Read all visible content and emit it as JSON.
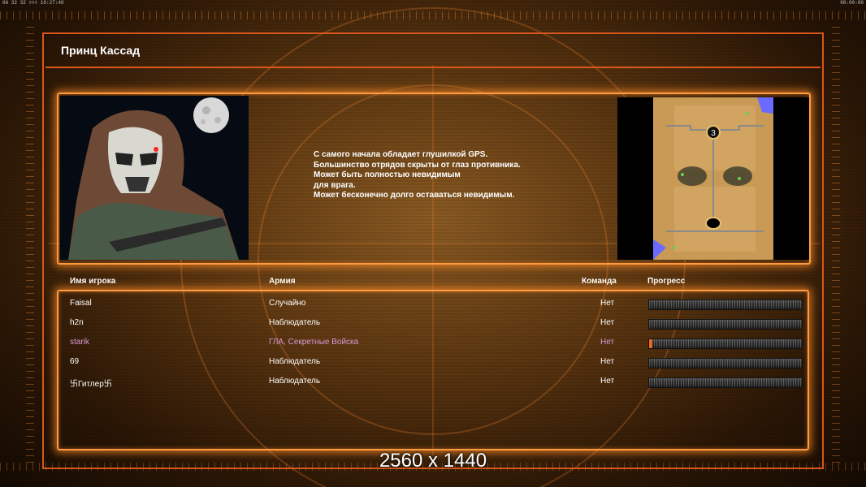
{
  "status": {
    "left": "06 32 32 ◊◊◊ 10:27:40",
    "right": "00:00:00"
  },
  "title": "Принц Кассад",
  "description": [
    "С самого начала обладает глушилкой GPS.",
    "Большинство отрядов скрыты от глаз противника.",
    "Может быть полностью невидимым",
    "для врага.",
    "Может бесконечно долго оставаться невидимым."
  ],
  "minimap": {
    "marker": "3"
  },
  "columns": {
    "player": "Имя игрока",
    "army": "Армия",
    "team": "Команда",
    "progress": "Прогресс"
  },
  "players": [
    {
      "name": "Faisal",
      "army": "Случайно",
      "team": "Нет",
      "progress": 0,
      "highlight": false
    },
    {
      "name": "h2n",
      "army": "Наблюдатель",
      "team": "Нет",
      "progress": 0,
      "highlight": false
    },
    {
      "name": "starik",
      "army": "ГЛА, Секретные Войска",
      "team": "Нет",
      "progress": 0.02,
      "highlight": true
    },
    {
      "name": "69",
      "army": "Наблюдатель",
      "team": "Нет",
      "progress": 0,
      "highlight": false
    },
    {
      "name": "卐Гитлер卐",
      "army": "Наблюдатель",
      "team": "Нет",
      "progress": 0,
      "highlight": false
    }
  ],
  "watermark": "2560 x 1440",
  "colors": {
    "frame": "#d9571a",
    "glow": "#ff9a40",
    "highlight_player": "#d69ad6",
    "progress_fill": "#e86a1a"
  }
}
